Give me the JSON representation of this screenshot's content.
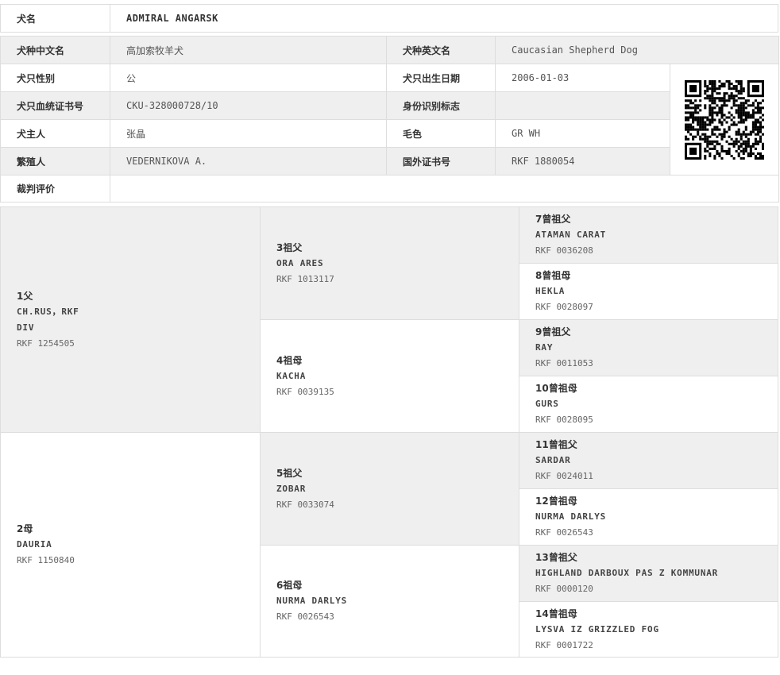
{
  "name_row": {
    "label": "犬名",
    "value": "ADMIRAL ANGARSK"
  },
  "info": {
    "breed_cn_label": "犬种中文名",
    "breed_cn": "高加索牧羊犬",
    "breed_en_label": "犬种英文名",
    "breed_en": "Caucasian Shepherd Dog",
    "sex_label": "犬只性别",
    "sex": "公",
    "dob_label": "犬只出生日期",
    "dob": "2006-01-03",
    "cert_label": "犬只血统证书号",
    "cert": "CKU-328000728/10",
    "id_label": "身份识别标志",
    "id": "",
    "owner_label": "犬主人",
    "owner": "张晶",
    "color_label": "毛色",
    "color": "GR WH",
    "breeder_label": "繁殖人",
    "breeder": "VEDERNIKOVA A.",
    "foreign_label": "国外证书号",
    "foreign": "RKF 1880054",
    "judge_label": "裁判评价",
    "judge": ""
  },
  "pedigree": {
    "p1": {
      "rel": "1父",
      "name_line1": "CH.RUS，RKF",
      "name_line2": "DIV",
      "reg": "RKF 1254505"
    },
    "p2": {
      "rel": "2母",
      "name": "DAURIA",
      "reg": "RKF 1150840"
    },
    "p3": {
      "rel": "3祖父",
      "name": "ORA ARES",
      "reg": "RKF 1013117"
    },
    "p4": {
      "rel": "4祖母",
      "name": "KACHA",
      "reg": "RKF 0039135"
    },
    "p5": {
      "rel": "5祖父",
      "name": "ZOBAR",
      "reg": "RKF 0033074"
    },
    "p6": {
      "rel": "6祖母",
      "name": "NURMA DARLYS",
      "reg": "RKF 0026543"
    },
    "p7": {
      "rel": "7曾祖父",
      "name": "ATAMAN CARAT",
      "reg": "RKF 0036208"
    },
    "p8": {
      "rel": "8曾祖母",
      "name": "HEKLA",
      "reg": "RKF 0028097"
    },
    "p9": {
      "rel": "9曾祖父",
      "name": "RAY",
      "reg": "RKF 0011053"
    },
    "p10": {
      "rel": "10曾祖母",
      "name": "GURS",
      "reg": "RKF 0028095"
    },
    "p11": {
      "rel": "11曾祖父",
      "name": "SARDAR",
      "reg": "RKF 0024011"
    },
    "p12": {
      "rel": "12曾祖母",
      "name": "NURMA DARLYS",
      "reg": "RKF 0026543"
    },
    "p13": {
      "rel": "13曾祖父",
      "name": "HIGHLAND DARBOUX PAS Z KOMMUNAR",
      "reg": "RKF 0000120"
    },
    "p14": {
      "rel": "14曾祖母",
      "name": "LYSVA IZ GRIZZLED FOG",
      "reg": "RKF 0001722"
    }
  },
  "colors": {
    "header_gray": "#efefef",
    "border": "#dddddd"
  },
  "icons": {
    "qr": "qr-code-icon"
  }
}
